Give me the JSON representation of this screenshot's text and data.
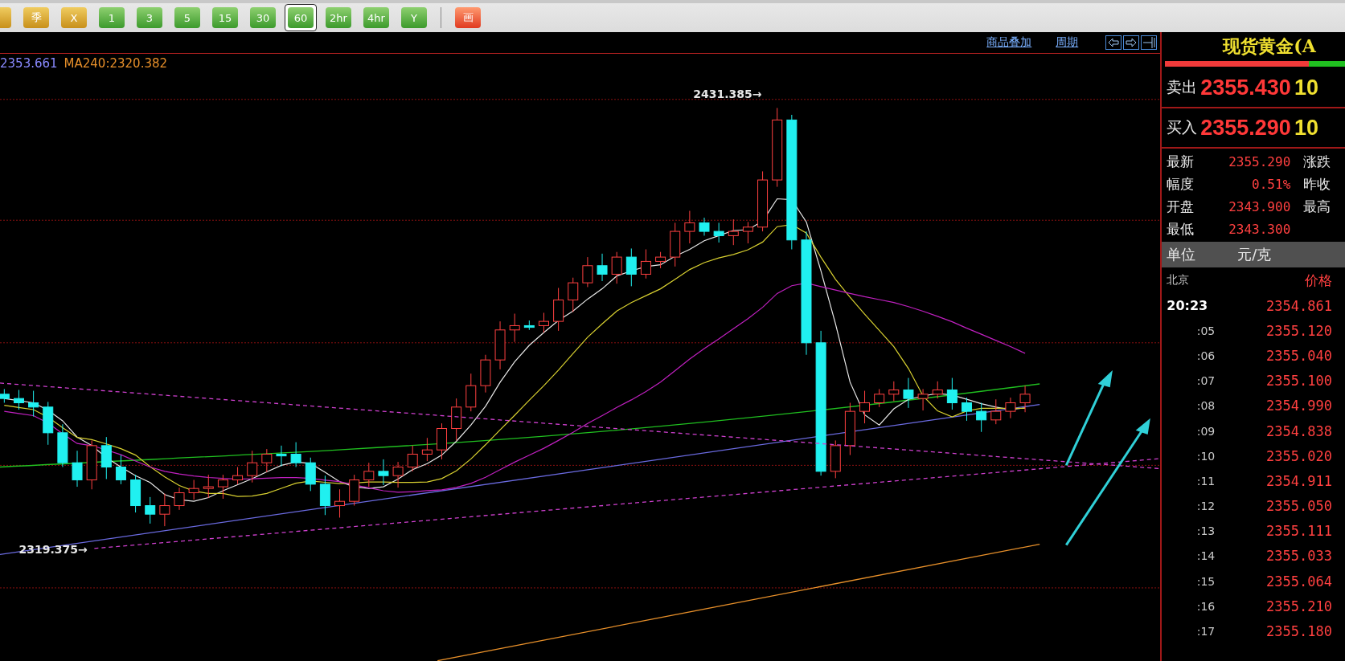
{
  "toolbar": {
    "buttons": [
      {
        "kind": "yellow",
        "selected": false
      },
      {
        "kind": "yellow",
        "label": "季",
        "selected": false
      },
      {
        "kind": "yellow",
        "label": "X",
        "selected": false
      },
      {
        "kind": "green",
        "label": "1",
        "selected": false
      },
      {
        "kind": "green",
        "label": "3",
        "selected": false
      },
      {
        "kind": "green",
        "label": "5",
        "selected": false
      },
      {
        "kind": "green",
        "label": "15",
        "selected": false
      },
      {
        "kind": "green",
        "label": "30",
        "selected": false
      },
      {
        "kind": "green",
        "label": "60",
        "selected": true
      },
      {
        "kind": "green",
        "label": "2hr",
        "selected": false
      },
      {
        "kind": "green",
        "label": "4hr",
        "selected": false
      },
      {
        "kind": "green",
        "label": "Y",
        "selected": false
      },
      {
        "kind": "red",
        "label": "画",
        "selected": false
      }
    ]
  },
  "chart": {
    "links": [
      "商品叠加",
      "周期"
    ],
    "legend": [
      {
        "text": "2353.661",
        "color": "#8a8aff"
      },
      {
        "text": "MA240:2320.382",
        "color": "#e8902a"
      }
    ],
    "annotations": [
      {
        "kind": "high",
        "text": "2431.385→"
      },
      {
        "kind": "low",
        "text": "2319.375→"
      }
    ]
  },
  "panel": {
    "title": "现货黄金(A",
    "ratio_bar": {
      "level": 0.8
    },
    "quotes": [
      {
        "label": "卖出",
        "price": "2355.430",
        "volume": "10"
      },
      {
        "label": "买入",
        "price": "2355.290",
        "volume": "10"
      }
    ],
    "stats": [
      {
        "label": "最新",
        "value": "2355.290",
        "label_2": "涨跌"
      },
      {
        "label": "幅度",
        "value": "0.51%",
        "label_2": "昨收"
      },
      {
        "label": "开盘",
        "value": "2343.900",
        "label_2": "最高"
      },
      {
        "label": "最低",
        "value": "2343.300"
      }
    ],
    "unit": {
      "label": "单位",
      "value": "元/克"
    },
    "ticks_header": {
      "time": "北京",
      "price": "价格"
    },
    "ticks": [
      {
        "kind": "latest",
        "time": "20:23",
        "price": "2354.861"
      },
      {
        "kind": "tick",
        "time": ":05",
        "price": "2355.120"
      },
      {
        "kind": "tick",
        "time": ":06",
        "price": "2355.040"
      },
      {
        "kind": "tick",
        "time": ":07",
        "price": "2355.100"
      },
      {
        "kind": "tick",
        "time": ":08",
        "price": "2354.990"
      },
      {
        "kind": "tick",
        "time": ":09",
        "price": "2354.838"
      },
      {
        "kind": "tick",
        "time": ":10",
        "price": "2355.020"
      },
      {
        "kind": "tick",
        "time": ":11",
        "price": "2354.911"
      },
      {
        "kind": "tick",
        "time": ":12",
        "price": "2355.050"
      },
      {
        "kind": "tick",
        "time": ":13",
        "price": "2355.111"
      },
      {
        "kind": "tick",
        "time": ":14",
        "price": "2355.033"
      },
      {
        "kind": "tick",
        "time": ":15",
        "price": "2355.064"
      },
      {
        "kind": "tick",
        "time": ":16",
        "price": "2355.210"
      },
      {
        "kind": "tick",
        "time": ":17",
        "price": "2355.180"
      }
    ]
  }
}
